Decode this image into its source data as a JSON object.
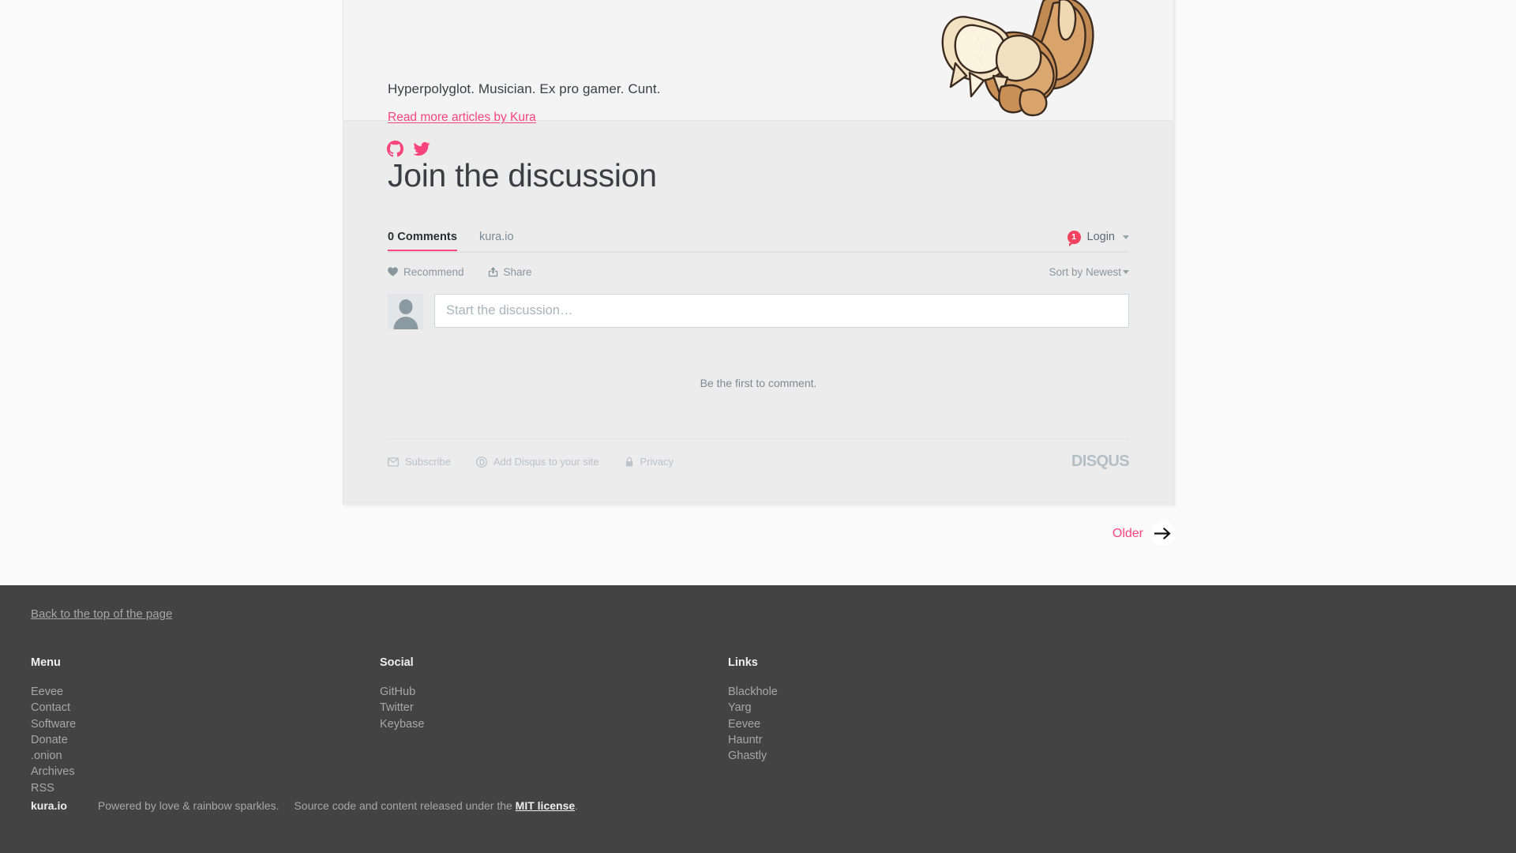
{
  "article": {
    "bio": "Hyperpolyglot. Musician. Ex pro gamer. Cunt.",
    "read_more_label": "Read more articles by Kura",
    "social_icons": [
      {
        "name": "github-icon",
        "label": "GitHub"
      },
      {
        "name": "twitter-icon",
        "label": "Twitter"
      }
    ],
    "illustration_alt": "Eevee"
  },
  "disqus": {
    "title": "Join the discussion",
    "tab_comments": "0 Comments",
    "tab_site": "kura.io",
    "login_badge": "1",
    "login_label": "Login",
    "recommend_label": "Recommend",
    "share_label": "Share",
    "sort_label": "Sort by Newest",
    "composer_placeholder": "Start the discussion…",
    "composer_value": "",
    "empty_message": "Be the first to comment.",
    "subscribe_label": "Subscribe",
    "add_disqus_label": "Add Disqus to your site",
    "privacy_label": "Privacy",
    "brand": "DISQUS"
  },
  "pager": {
    "older_label": "Older"
  },
  "footer": {
    "back_to_top": "Back to the top of the page",
    "columns": [
      {
        "heading": "Menu",
        "items": [
          "Eevee",
          "Contact",
          "Software",
          "Donate",
          ".onion",
          "Archives",
          "RSS"
        ]
      },
      {
        "heading": "Social",
        "items": [
          "GitHub",
          "Twitter",
          "Keybase"
        ]
      },
      {
        "heading": "Links",
        "items": [
          "Blackhole",
          "Yarg",
          "Eevee",
          "Hauntr",
          "Ghastly"
        ]
      }
    ],
    "bottom": {
      "brand": "kura.io",
      "tagline": "Powered by love & rainbow sparkles.",
      "license_prefix": "Source code and content released under the",
      "license_link": "MIT license",
      "license_suffix": "."
    }
  },
  "colors": {
    "accent_pink": "#f8447e",
    "disqus_pink": "#f54b7e",
    "badge_red": "#f4435f",
    "footer_bg": "#434343",
    "card_bg": "#f4f4f4",
    "disqus_bg": "#ececec"
  }
}
